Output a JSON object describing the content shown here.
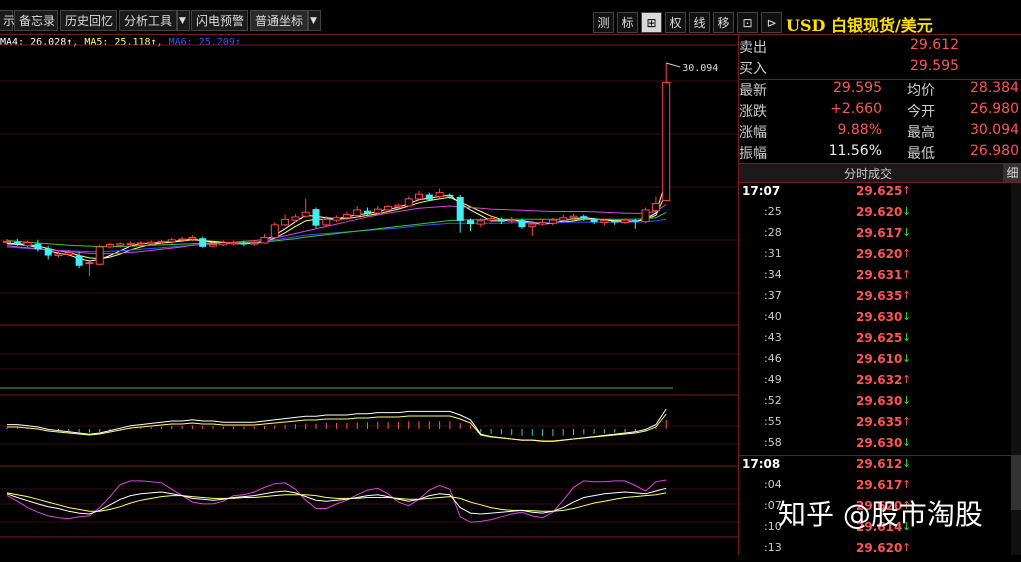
{
  "toolbar": {
    "items": [
      {
        "label": "示"
      },
      {
        "label": "备忘录"
      },
      {
        "label": "历史回忆"
      },
      {
        "label": "分析工具"
      },
      {
        "label": "闪电预警"
      },
      {
        "label": "普通坐标"
      }
    ],
    "dropdown_glyph": "▼",
    "right_buttons": [
      "测",
      "标",
      "⊞",
      "权",
      "线",
      "移",
      "⊡",
      "⊳"
    ],
    "title": "USD 白银现货/美元"
  },
  "ma_legend": [
    {
      "text": "MA4: 26.028↑,",
      "color": "#ffffff"
    },
    {
      "text": "MA5: 25.118↑,",
      "color": "#ffff66"
    },
    {
      "text": "MA6: 25.209↑",
      "color": "#3355ff"
    }
  ],
  "chart_data": {
    "type": "candlestick",
    "high_annotation": "30.094",
    "candles": [
      {
        "open": 25.56,
        "close": 25.56,
        "high": 25.62,
        "low": 25.52
      },
      {
        "open": 25.55,
        "close": 25.48,
        "high": 25.62,
        "low": 25.44
      },
      {
        "open": 25.45,
        "close": 25.53,
        "high": 25.58,
        "low": 25.4
      },
      {
        "open": 25.5,
        "close": 25.36,
        "high": 25.6,
        "low": 25.3
      },
      {
        "open": 25.38,
        "close": 25.2,
        "high": 25.45,
        "low": 25.1
      },
      {
        "open": 25.2,
        "close": 25.24,
        "high": 25.3,
        "low": 25.15
      },
      {
        "open": 25.23,
        "close": 25.27,
        "high": 25.34,
        "low": 25.18
      },
      {
        "open": 25.2,
        "close": 24.94,
        "high": 25.3,
        "low": 24.88
      },
      {
        "open": 25.0,
        "close": 25.02,
        "high": 25.05,
        "low": 24.68
      },
      {
        "open": 24.98,
        "close": 25.42,
        "high": 25.48,
        "low": 24.95
      },
      {
        "open": 25.42,
        "close": 25.48,
        "high": 25.53,
        "low": 25.38
      },
      {
        "open": 25.46,
        "close": 25.5,
        "high": 25.53,
        "low": 25.4
      },
      {
        "open": 25.48,
        "close": 25.51,
        "high": 25.56,
        "low": 25.45
      },
      {
        "open": 25.5,
        "close": 25.52,
        "high": 25.56,
        "low": 25.46
      },
      {
        "open": 25.5,
        "close": 25.54,
        "high": 25.58,
        "low": 25.46
      },
      {
        "open": 25.54,
        "close": 25.56,
        "high": 25.6,
        "low": 25.5
      },
      {
        "open": 25.55,
        "close": 25.6,
        "high": 25.65,
        "low": 25.5
      },
      {
        "open": 25.6,
        "close": 25.62,
        "high": 25.68,
        "low": 25.54
      },
      {
        "open": 25.62,
        "close": 25.66,
        "high": 25.72,
        "low": 25.56
      },
      {
        "open": 25.64,
        "close": 25.42,
        "high": 25.68,
        "low": 25.4
      },
      {
        "open": 25.44,
        "close": 25.48,
        "high": 25.55,
        "low": 25.4
      },
      {
        "open": 25.47,
        "close": 25.52,
        "high": 25.58,
        "low": 25.44
      },
      {
        "open": 25.5,
        "close": 25.53,
        "high": 25.58,
        "low": 25.46
      },
      {
        "open": 25.52,
        "close": 25.48,
        "high": 25.58,
        "low": 25.44
      },
      {
        "open": 25.49,
        "close": 25.52,
        "high": 25.6,
        "low": 25.45
      },
      {
        "open": 25.52,
        "close": 25.66,
        "high": 25.74,
        "low": 25.5
      },
      {
        "open": 25.66,
        "close": 25.98,
        "high": 26.04,
        "low": 25.64
      },
      {
        "open": 25.98,
        "close": 26.12,
        "high": 26.24,
        "low": 25.95
      },
      {
        "open": 26.1,
        "close": 26.18,
        "high": 26.26,
        "low": 26.05
      },
      {
        "open": 26.2,
        "close": 26.3,
        "high": 26.64,
        "low": 26.16
      },
      {
        "open": 26.38,
        "close": 25.96,
        "high": 26.42,
        "low": 25.9
      },
      {
        "open": 25.98,
        "close": 26.12,
        "high": 26.2,
        "low": 25.94
      },
      {
        "open": 26.1,
        "close": 26.16,
        "high": 26.22,
        "low": 26.05
      },
      {
        "open": 26.16,
        "close": 26.24,
        "high": 26.32,
        "low": 26.1
      },
      {
        "open": 26.22,
        "close": 26.36,
        "high": 26.46,
        "low": 26.18
      },
      {
        "open": 26.34,
        "close": 26.26,
        "high": 26.42,
        "low": 26.2
      },
      {
        "open": 26.28,
        "close": 26.38,
        "high": 26.46,
        "low": 26.24
      },
      {
        "open": 26.36,
        "close": 26.45,
        "high": 26.48,
        "low": 26.32
      },
      {
        "open": 26.44,
        "close": 26.48,
        "high": 26.52,
        "low": 26.4
      },
      {
        "open": 26.46,
        "close": 26.64,
        "high": 26.7,
        "low": 26.44
      },
      {
        "open": 26.64,
        "close": 26.76,
        "high": 26.84,
        "low": 26.6
      },
      {
        "open": 26.75,
        "close": 26.62,
        "high": 26.8,
        "low": 26.58
      },
      {
        "open": 26.7,
        "close": 26.8,
        "high": 26.9,
        "low": 26.66
      },
      {
        "open": 26.74,
        "close": 26.7,
        "high": 26.78,
        "low": 26.64
      },
      {
        "open": 26.69,
        "close": 26.08,
        "high": 26.74,
        "low": 25.78
      },
      {
        "open": 26.1,
        "close": 26.0,
        "high": 26.14,
        "low": 25.82
      },
      {
        "open": 26.0,
        "close": 26.08,
        "high": 26.15,
        "low": 25.92
      },
      {
        "open": 26.1,
        "close": 26.14,
        "high": 26.2,
        "low": 26.04
      },
      {
        "open": 26.12,
        "close": 26.06,
        "high": 26.16,
        "low": 26.0
      },
      {
        "open": 26.08,
        "close": 26.1,
        "high": 26.18,
        "low": 26.02
      },
      {
        "open": 26.1,
        "close": 25.92,
        "high": 26.14,
        "low": 25.88
      },
      {
        "open": 25.94,
        "close": 26.0,
        "high": 26.08,
        "low": 25.7
      },
      {
        "open": 26.0,
        "close": 26.04,
        "high": 26.12,
        "low": 25.96
      },
      {
        "open": 26.02,
        "close": 26.1,
        "high": 26.16,
        "low": 25.96
      },
      {
        "open": 26.1,
        "close": 26.16,
        "high": 26.24,
        "low": 26.06
      },
      {
        "open": 26.16,
        "close": 26.2,
        "high": 26.26,
        "low": 26.12
      },
      {
        "open": 26.2,
        "close": 26.14,
        "high": 26.24,
        "low": 26.08
      },
      {
        "open": 26.12,
        "close": 26.05,
        "high": 26.16,
        "low": 26.0
      },
      {
        "open": 26.04,
        "close": 26.09,
        "high": 26.14,
        "low": 25.96
      },
      {
        "open": 26.08,
        "close": 26.04,
        "high": 26.1,
        "low": 25.98
      },
      {
        "open": 26.04,
        "close": 26.1,
        "high": 26.14,
        "low": 26.0
      },
      {
        "open": 26.1,
        "close": 26.06,
        "high": 26.14,
        "low": 25.88
      },
      {
        "open": 26.06,
        "close": 26.36,
        "high": 26.42,
        "low": 26.02
      },
      {
        "open": 26.34,
        "close": 26.52,
        "high": 26.7,
        "low": 26.32
      },
      {
        "open": 26.6,
        "close": 29.6,
        "high": 30.094,
        "low": 26.58
      }
    ],
    "ma_lines": [
      {
        "name": "MA4",
        "color": "#ffffff",
        "values": [
          25.5,
          25.48,
          25.46,
          25.4,
          25.32,
          25.26,
          25.22,
          25.12,
          25.06,
          25.1,
          25.2,
          25.32,
          25.44,
          25.5,
          25.52,
          25.53,
          25.56,
          25.58,
          25.62,
          25.58,
          25.54,
          25.52,
          25.5,
          25.5,
          25.52,
          25.58,
          25.72,
          25.88,
          26.06,
          26.22,
          26.2,
          26.16,
          26.14,
          26.18,
          26.24,
          26.26,
          26.32,
          26.38,
          26.42,
          26.52,
          26.62,
          26.66,
          26.7,
          26.74,
          26.52,
          26.36,
          26.22,
          26.08,
          26.08,
          26.1,
          26.06,
          26.02,
          26.0,
          26.02,
          26.08,
          26.14,
          26.16,
          26.14,
          26.1,
          26.08,
          26.06,
          26.06,
          26.14,
          26.28,
          27.1
        ]
      },
      {
        "name": "MA5",
        "color": "#ffff66",
        "values": [
          25.52,
          25.5,
          25.48,
          25.44,
          25.38,
          25.32,
          25.28,
          25.2,
          25.14,
          25.12,
          25.16,
          25.24,
          25.34,
          25.42,
          25.48,
          25.52,
          25.54,
          25.57,
          25.6,
          25.58,
          25.56,
          25.54,
          25.52,
          25.51,
          25.51,
          25.54,
          25.64,
          25.78,
          25.94,
          26.08,
          26.12,
          26.12,
          26.12,
          26.14,
          26.18,
          26.22,
          26.26,
          26.32,
          26.38,
          26.46,
          26.54,
          26.6,
          26.64,
          26.68,
          26.56,
          26.44,
          26.32,
          26.2,
          26.12,
          26.1,
          26.08,
          26.05,
          26.02,
          26.02,
          26.05,
          26.08,
          26.12,
          26.12,
          26.11,
          26.09,
          26.08,
          26.07,
          26.12,
          26.22,
          26.8
        ]
      },
      {
        "name": "MA6",
        "color": "#3355ff",
        "values": [
          25.42,
          25.4,
          25.38,
          25.36,
          25.34,
          25.33,
          25.32,
          25.31,
          25.3,
          25.3,
          25.31,
          25.32,
          25.34,
          25.36,
          25.38,
          25.4,
          25.42,
          25.44,
          25.46,
          25.48,
          25.49,
          25.5,
          25.51,
          25.52,
          25.54,
          25.56,
          25.6,
          25.64,
          25.68,
          25.72,
          25.74,
          25.76,
          25.78,
          25.8,
          25.82,
          25.84,
          25.86,
          25.88,
          25.9,
          25.93,
          25.96,
          25.98,
          26.0,
          26.02,
          26.02,
          26.02,
          26.02,
          26.02,
          26.02,
          26.03,
          26.03,
          26.03,
          26.03,
          26.04,
          26.04,
          26.05,
          26.05,
          26.05,
          26.05,
          26.05,
          26.05,
          26.05,
          26.06,
          26.08,
          26.12
        ]
      },
      {
        "name": "MA-green",
        "color": "#33cc33",
        "values": [
          25.58,
          25.56,
          25.54,
          25.52,
          25.5,
          25.48,
          25.46,
          25.45,
          25.44,
          25.43,
          25.43,
          25.43,
          25.44,
          25.45,
          25.46,
          25.47,
          25.48,
          25.49,
          25.5,
          25.51,
          25.52,
          25.52,
          25.53,
          25.53,
          25.54,
          25.55,
          25.57,
          25.6,
          25.63,
          25.67,
          25.7,
          25.73,
          25.76,
          25.79,
          25.82,
          25.85,
          25.88,
          25.91,
          25.94,
          25.97,
          26.0,
          26.03,
          26.06,
          26.09,
          26.1,
          26.11,
          26.11,
          26.12,
          26.12,
          26.12,
          26.12,
          26.12,
          26.12,
          26.12,
          26.12,
          26.12,
          26.12,
          26.12,
          26.12,
          26.12,
          26.12,
          26.12,
          26.14,
          26.16,
          26.3
        ]
      },
      {
        "name": "MA-magenta",
        "color": "#dd44dd",
        "values": [
          25.45,
          25.42,
          25.4,
          25.37,
          25.35,
          25.32,
          25.3,
          25.28,
          25.26,
          25.25,
          25.25,
          25.26,
          25.28,
          25.3,
          25.33,
          25.36,
          25.39,
          25.42,
          25.46,
          25.48,
          25.5,
          25.52,
          25.54,
          25.56,
          25.58,
          25.61,
          25.65,
          25.7,
          25.76,
          25.82,
          25.88,
          25.94,
          26.0,
          26.06,
          26.12,
          26.18,
          26.23,
          26.28,
          26.32,
          26.36,
          26.4,
          26.42,
          26.44,
          26.46,
          26.44,
          26.42,
          26.4,
          26.38,
          26.37,
          26.36,
          26.35,
          26.34,
          26.33,
          26.32,
          26.32,
          26.32,
          26.32,
          26.31,
          26.3,
          26.29,
          26.28,
          26.27,
          26.28,
          26.32,
          26.5
        ]
      }
    ],
    "macd_hist": [
      0.02,
      0.02,
      0.01,
      0.0,
      -0.02,
      -0.03,
      -0.04,
      -0.05,
      -0.06,
      -0.05,
      -0.03,
      -0.01,
      0.01,
      0.02,
      0.03,
      0.04,
      0.05,
      0.05,
      0.06,
      0.05,
      0.05,
      0.04,
      0.04,
      0.04,
      0.04,
      0.05,
      0.06,
      0.07,
      0.08,
      0.09,
      0.09,
      0.1,
      0.1,
      0.1,
      0.11,
      0.11,
      0.12,
      0.12,
      0.12,
      0.13,
      0.13,
      0.13,
      0.13,
      0.13,
      0.1,
      0.06,
      -0.06,
      -0.08,
      -0.09,
      -0.1,
      -0.11,
      -0.11,
      -0.12,
      -0.12,
      -0.11,
      -0.1,
      -0.09,
      -0.08,
      -0.07,
      -0.06,
      -0.05,
      -0.04,
      -0.02,
      0.02,
      0.15
    ],
    "kdj_k": [
      70,
      62,
      55,
      48,
      42,
      38,
      32,
      28,
      26,
      34,
      46,
      58,
      66,
      70,
      72,
      74,
      70,
      66,
      60,
      58,
      56,
      58,
      62,
      64,
      66,
      70,
      74,
      76,
      72,
      64,
      56,
      54,
      56,
      58,
      62,
      66,
      68,
      64,
      58,
      54,
      58,
      66,
      70,
      68,
      40,
      28,
      26,
      28,
      30,
      32,
      34,
      30,
      28,
      32,
      40,
      52,
      62,
      66,
      70,
      72,
      74,
      72,
      70,
      76,
      82
    ],
    "kdj_d": [
      72,
      68,
      64,
      58,
      52,
      46,
      40,
      36,
      32,
      32,
      36,
      42,
      50,
      56,
      60,
      64,
      66,
      66,
      64,
      62,
      60,
      60,
      60,
      62,
      62,
      64,
      66,
      68,
      68,
      68,
      66,
      62,
      60,
      60,
      60,
      62,
      62,
      62,
      60,
      58,
      58,
      60,
      62,
      64,
      60,
      52,
      46,
      40,
      36,
      34,
      34,
      33,
      32,
      32,
      34,
      38,
      44,
      50,
      54,
      58,
      62,
      64,
      66,
      68,
      72
    ],
    "kdj_j": [
      66,
      54,
      40,
      30,
      22,
      18,
      16,
      20,
      22,
      40,
      64,
      90,
      98,
      98,
      96,
      94,
      80,
      66,
      52,
      48,
      48,
      54,
      66,
      68,
      74,
      84,
      92,
      94,
      80,
      56,
      38,
      38,
      48,
      56,
      68,
      78,
      82,
      70,
      52,
      44,
      58,
      78,
      88,
      80,
      20,
      8,
      10,
      14,
      20,
      26,
      30,
      22,
      18,
      30,
      56,
      84,
      98,
      96,
      96,
      98,
      98,
      88,
      76,
      96,
      100
    ]
  },
  "quote": {
    "sell": {
      "label": "卖出",
      "value": "29.612"
    },
    "buy": {
      "label": "买入",
      "value": "29.595"
    },
    "latest": {
      "label": "最新",
      "value": "29.595"
    },
    "avg": {
      "label": "均价",
      "value": "28.384"
    },
    "change": {
      "label": "涨跌",
      "value": "+2.660"
    },
    "open": {
      "label": "今开",
      "value": "26.980"
    },
    "pct": {
      "label": "涨幅",
      "value": "9.88%"
    },
    "high": {
      "label": "最高",
      "value": "30.094"
    },
    "amplitude": {
      "label": "振幅",
      "value": "11.56%"
    },
    "low": {
      "label": "最低",
      "value": "26.980"
    }
  },
  "trades": {
    "header": "分时成交",
    "detail_button": "细",
    "rows": [
      {
        "time": "17:07",
        "full": true,
        "price": "29.625",
        "dir": "up"
      },
      {
        "time": ":25",
        "full": false,
        "price": "29.620",
        "dir": "down"
      },
      {
        "time": ":28",
        "full": false,
        "price": "29.617",
        "dir": "down"
      },
      {
        "time": ":31",
        "full": false,
        "price": "29.620",
        "dir": "up"
      },
      {
        "time": ":34",
        "full": false,
        "price": "29.631",
        "dir": "up"
      },
      {
        "time": ":37",
        "full": false,
        "price": "29.635",
        "dir": "up"
      },
      {
        "time": ":40",
        "full": false,
        "price": "29.630",
        "dir": "down"
      },
      {
        "time": ":43",
        "full": false,
        "price": "29.625",
        "dir": "down"
      },
      {
        "time": ":46",
        "full": false,
        "price": "29.610",
        "dir": "down"
      },
      {
        "time": ":49",
        "full": false,
        "price": "29.632",
        "dir": "up"
      },
      {
        "time": ":52",
        "full": false,
        "price": "29.630",
        "dir": "down"
      },
      {
        "time": ":55",
        "full": false,
        "price": "29.635",
        "dir": "up"
      },
      {
        "time": ":58",
        "full": false,
        "price": "29.630",
        "dir": "down"
      },
      {
        "time": "17:08",
        "full": true,
        "price": "29.612",
        "dir": "down"
      },
      {
        "time": ":04",
        "full": false,
        "price": "29.617",
        "dir": "up"
      },
      {
        "time": ":07",
        "full": false,
        "price": "29.620",
        "dir": "up"
      },
      {
        "time": ":10",
        "full": false,
        "price": "29.614",
        "dir": "down"
      },
      {
        "time": ":13",
        "full": false,
        "price": "29.620",
        "dir": "up"
      }
    ]
  },
  "watermark": "知乎 @股市淘股"
}
